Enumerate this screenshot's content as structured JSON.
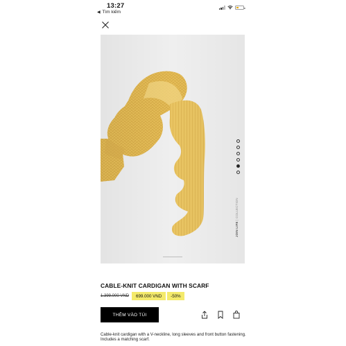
{
  "status_bar": {
    "time": "13:27",
    "back_label": "Tìm kiếm"
  },
  "product": {
    "title": "CABLE-KNIT CARDIGAN WITH SCARF",
    "old_price": "1.399.000 VND",
    "new_price": "699.000 VND",
    "discount": "-50%",
    "add_to_bag_label": "THÊM VÀO TÚI",
    "description": "Cable-knit cardigan with a V-neckline, long sleeves and front button fastening. Includes a matching scarf."
  },
  "gallery": {
    "image_count": 6,
    "active_index": 4,
    "vertical_text_bold": "JOIN LIFE",
    "vertical_text_light": "COLLECTION"
  },
  "colors": {
    "price_highlight": "#f4ea6b",
    "button_bg": "#000000",
    "scarf_yellow": "#e8c25e"
  },
  "icons": {
    "close": "close-icon",
    "share": "share-icon",
    "bookmark": "bookmark-icon",
    "bag": "bag-icon"
  }
}
